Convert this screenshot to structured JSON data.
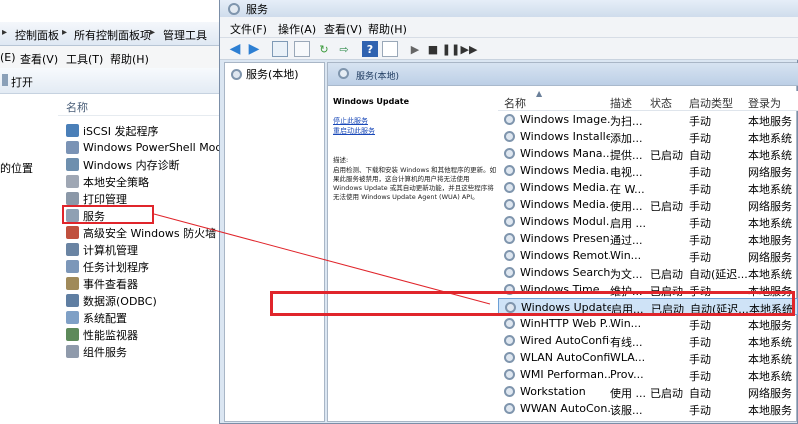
{
  "background_window": {
    "address_bar": {
      "crumbs": [
        "控制面板",
        "所有控制面板项",
        "管理工具"
      ],
      "separator": "▸"
    },
    "menu": [
      "查看(V)",
      "工具(T)",
      "帮助(H)"
    ],
    "menu_partial_left": "(E)",
    "command": {
      "open_label": "打开"
    },
    "nav_partial": "的位置",
    "list": {
      "column_name": "名称",
      "items": [
        {
          "label": "iSCSI 发起程序",
          "icon": "iscsi-icon"
        },
        {
          "label": "Windows PowerShell Modules",
          "icon": "powershell-icon"
        },
        {
          "label": "Windows 内存诊断",
          "icon": "memory-diagnostic-icon"
        },
        {
          "label": "本地安全策略",
          "icon": "security-policy-icon"
        },
        {
          "label": "打印管理",
          "icon": "printer-icon"
        },
        {
          "label": "服务",
          "icon": "services-icon"
        },
        {
          "label": "高级安全 Windows 防火墙",
          "icon": "firewall-icon"
        },
        {
          "label": "计算机管理",
          "icon": "computer-management-icon"
        },
        {
          "label": "任务计划程序",
          "icon": "task-scheduler-icon"
        },
        {
          "label": "事件查看器",
          "icon": "event-viewer-icon"
        },
        {
          "label": "数据源(ODBC)",
          "icon": "odbc-icon"
        },
        {
          "label": "系统配置",
          "icon": "system-config-icon"
        },
        {
          "label": "性能监视器",
          "icon": "performance-monitor-icon"
        },
        {
          "label": "组件服务",
          "icon": "component-services-icon"
        }
      ]
    }
  },
  "services_window": {
    "title": "服务",
    "menu": [
      "文件(F)",
      "操作(A)",
      "查看(V)",
      "帮助(H)"
    ],
    "tree_item": "服务(本地)",
    "content_header": "服务(本地)",
    "detail": {
      "service_name": "Windows Update",
      "stop_link": "停止此服务",
      "restart_link": "重启动此服务",
      "description_label": "描述:",
      "description_lines": [
        "启用检测、下载和安装 Windows 和其他程序的更新。如",
        "果此服务被禁用，这台计算机的用户将无法使用",
        "Windows Update 或其自动更新功能，并且这些程序将",
        "无法使用 Windows Update Agent (WUA) API。"
      ]
    },
    "columns": [
      "名称",
      "描述",
      "状态",
      "启动类型",
      "登录为"
    ],
    "rows": [
      {
        "name": "Windows Image...",
        "desc": "为扫...",
        "status": "",
        "startup": "手动",
        "logon": "本地服务"
      },
      {
        "name": "Windows Installer",
        "desc": "添加...",
        "status": "",
        "startup": "手动",
        "logon": "本地系统"
      },
      {
        "name": "Windows Mana...",
        "desc": "提供...",
        "status": "已启动",
        "startup": "自动",
        "logon": "本地系统"
      },
      {
        "name": "Windows Media...",
        "desc": "电视...",
        "status": "",
        "startup": "手动",
        "logon": "网络服务"
      },
      {
        "name": "Windows Media...",
        "desc": "在 W...",
        "status": "",
        "startup": "手动",
        "logon": "本地系统"
      },
      {
        "name": "Windows Media...",
        "desc": "使用...",
        "status": "已启动",
        "startup": "手动",
        "logon": "网络服务"
      },
      {
        "name": "Windows Modul...",
        "desc": "启用 ...",
        "status": "",
        "startup": "手动",
        "logon": "本地系统"
      },
      {
        "name": "Windows Presen...",
        "desc": "通过...",
        "status": "",
        "startup": "手动",
        "logon": "本地服务"
      },
      {
        "name": "Windows Remot...",
        "desc": "Win...",
        "status": "",
        "startup": "手动",
        "logon": "网络服务"
      },
      {
        "name": "Windows Search",
        "desc": "为文...",
        "status": "已启动",
        "startup": "自动(延迟...",
        "logon": "本地系统"
      },
      {
        "name": "Windows Time",
        "desc": "维护...",
        "status": "已启动",
        "startup": "手动",
        "logon": "本地服务"
      },
      {
        "name": "Windows Update",
        "desc": "启用...",
        "status": "已启动",
        "startup": "自动(延迟...",
        "logon": "本地系统",
        "selected": true
      },
      {
        "name": "WinHTTP Web P...",
        "desc": "Win...",
        "status": "",
        "startup": "手动",
        "logon": "本地服务"
      },
      {
        "name": "Wired AutoConfig",
        "desc": "有线...",
        "status": "",
        "startup": "手动",
        "logon": "本地系统"
      },
      {
        "name": "WLAN AutoConfig",
        "desc": "WLA...",
        "status": "",
        "startup": "手动",
        "logon": "本地系统"
      },
      {
        "name": "WMI Performan...",
        "desc": "Prov...",
        "status": "",
        "startup": "手动",
        "logon": "本地系统"
      },
      {
        "name": "Workstation",
        "desc": "使用 ...",
        "status": "已启动",
        "startup": "自动",
        "logon": "网络服务"
      },
      {
        "name": "WWAN AutoCon...",
        "desc": "该服...",
        "status": "",
        "startup": "手动",
        "logon": "本地服务"
      }
    ]
  },
  "colors": {
    "highlight_red": "#e0252b",
    "selection_fill": "#cfe3f7",
    "link_blue": "#1a49b8"
  }
}
